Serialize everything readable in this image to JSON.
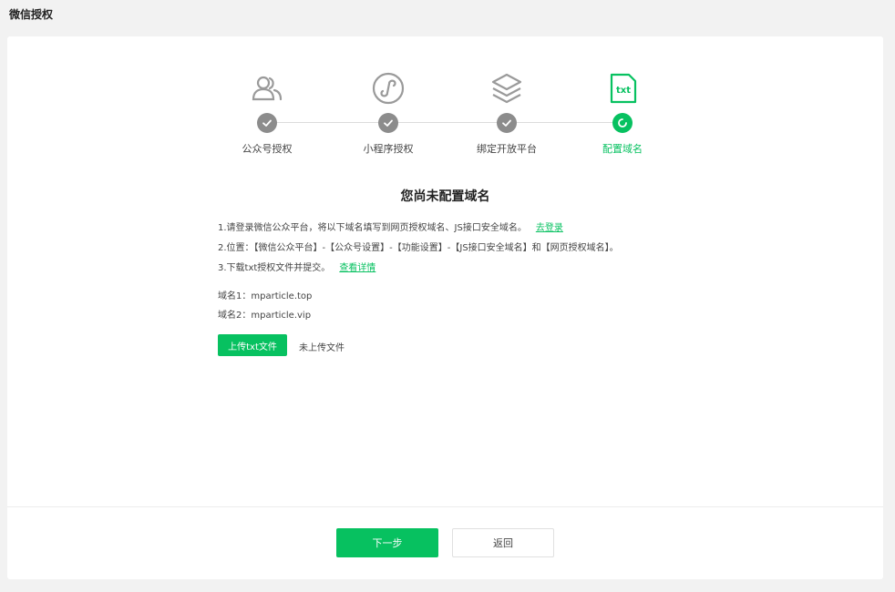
{
  "page": {
    "title": "微信授权"
  },
  "steps": [
    {
      "label": "公众号授权",
      "icon": "users-icon",
      "status": "done"
    },
    {
      "label": "小程序授权",
      "icon": "mini-program-icon",
      "status": "done"
    },
    {
      "label": "绑定开放平台",
      "icon": "layers-icon",
      "status": "done"
    },
    {
      "label": "配置域名",
      "icon": "txt-file-icon",
      "status": "active"
    }
  ],
  "main": {
    "title": "您尚未配置域名",
    "instruction1": "1.请登录微信公众平台，将以下域名填写到网页授权域名、JS接口安全域名。",
    "instruction1_link": "去登录",
    "instruction2": "2.位置：【微信公众平台】-【公众号设置】-【功能设置】-【JS接口安全域名】和【网页授权域名】。",
    "instruction3": "3.下载txt授权文件并提交。",
    "instruction3_link": "查看详情",
    "domain1": "域名1：mparticle.top",
    "domain2": "域名2：mparticle.vip",
    "upload_button": "上传txt文件",
    "upload_status": "未上传文件"
  },
  "footer": {
    "next_button": "下一步",
    "back_button": "返回"
  },
  "colors": {
    "accent": "#07c160",
    "done": "#8c8c8c",
    "icon": "#9a9a9a"
  }
}
